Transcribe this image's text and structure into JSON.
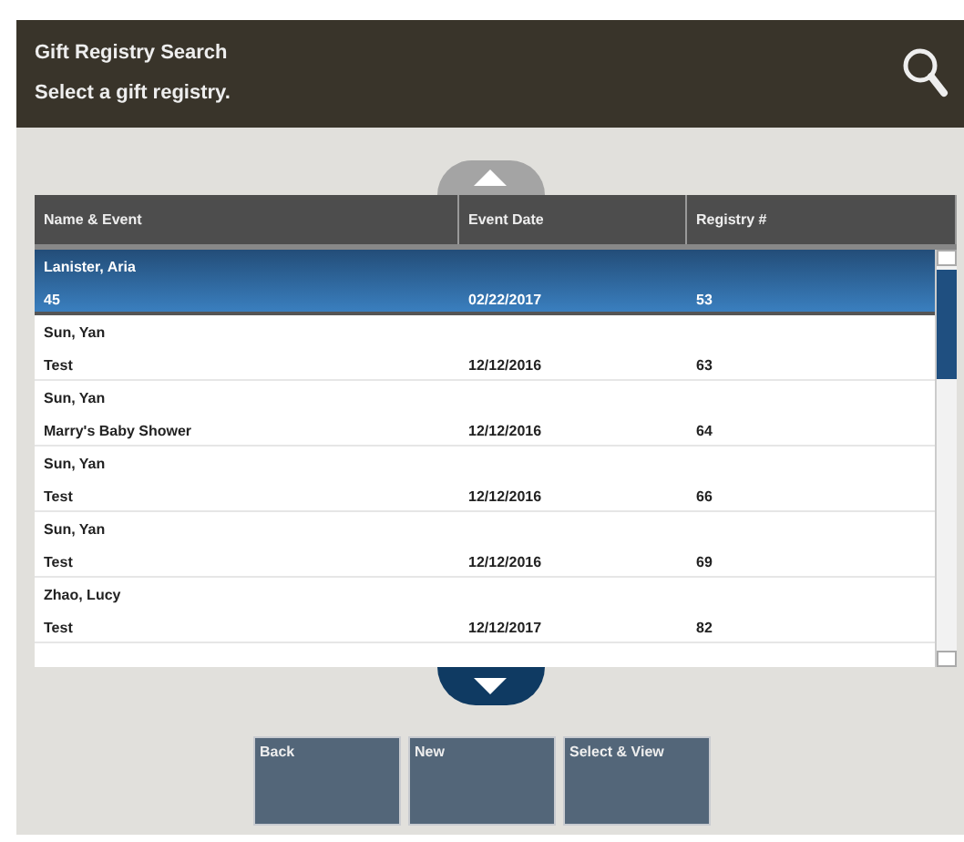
{
  "header": {
    "title": "Gift Registry Search",
    "prompt": "Select a gift registry."
  },
  "table": {
    "columns": [
      "Name & Event",
      "Event Date",
      "Registry #"
    ],
    "rows": [
      {
        "name": "Lanister, Aria",
        "event": "45",
        "date": "02/22/2017",
        "registry": "53",
        "selected": true
      },
      {
        "name": "Sun, Yan",
        "event": "Test",
        "date": "12/12/2016",
        "registry": "63",
        "selected": false
      },
      {
        "name": "Sun, Yan",
        "event": "Marry's Baby Shower",
        "date": "12/12/2016",
        "registry": "64",
        "selected": false
      },
      {
        "name": "Sun, Yan",
        "event": "Test",
        "date": "12/12/2016",
        "registry": "66",
        "selected": false
      },
      {
        "name": "Sun, Yan",
        "event": "Test",
        "date": "12/12/2016",
        "registry": "69",
        "selected": false
      },
      {
        "name": "Zhao, Lucy",
        "event": "Test",
        "date": "12/12/2017",
        "registry": "82",
        "selected": false
      }
    ]
  },
  "buttons": [
    "Back",
    "New",
    "Select & View"
  ]
}
